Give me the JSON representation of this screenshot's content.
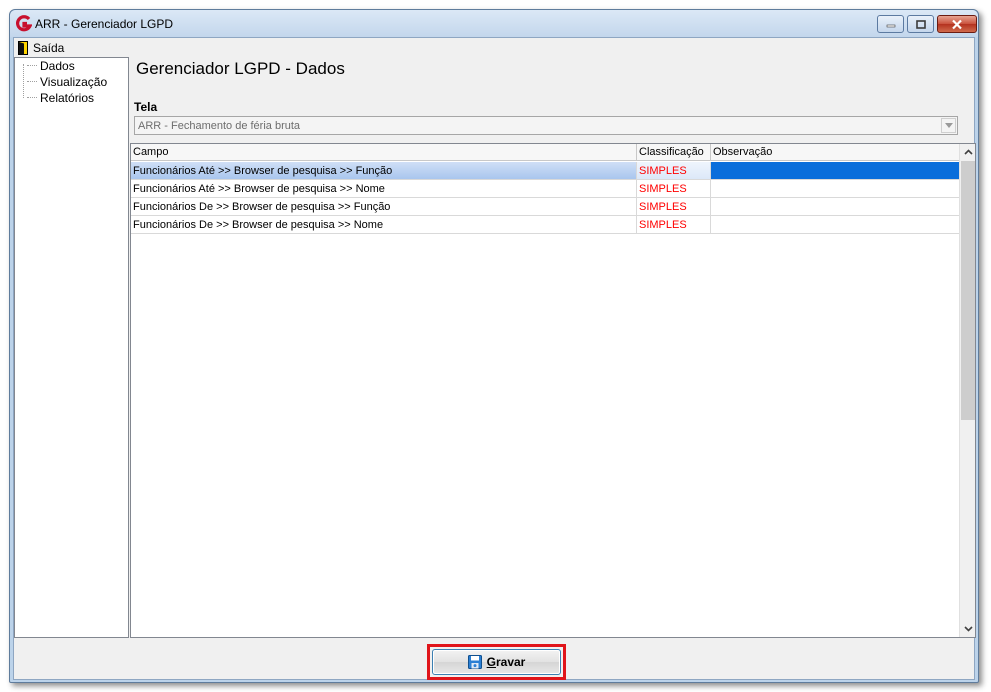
{
  "window": {
    "title": "ARR - Gerenciador LGPD"
  },
  "menu": {
    "saida": "Saída"
  },
  "nav": {
    "items": [
      {
        "label": "Dados"
      },
      {
        "label": "Visualização"
      },
      {
        "label": "Relatórios"
      }
    ]
  },
  "main": {
    "title": "Gerenciador LGPD - Dados",
    "tela_label": "Tela",
    "tela_value": "ARR - Fechamento de féria bruta"
  },
  "grid": {
    "columns": [
      "Campo",
      "Classificação",
      "Observação"
    ],
    "rows": [
      {
        "campo": "Funcionários Até >> Browser de pesquisa >> Função",
        "classificacao": "SIMPLES",
        "observacao": ""
      },
      {
        "campo": "Funcionários Até >> Browser de pesquisa >> Nome",
        "classificacao": "SIMPLES",
        "observacao": ""
      },
      {
        "campo": "Funcionários De >> Browser de pesquisa >> Função",
        "classificacao": "SIMPLES",
        "observacao": ""
      },
      {
        "campo": "Funcionários De >> Browser de pesquisa >> Nome",
        "classificacao": "SIMPLES",
        "observacao": ""
      }
    ],
    "selected_row": 0
  },
  "footer": {
    "gravar_label": "Gravar"
  },
  "colors": {
    "classification": "#ff0000",
    "selection": "#0a6edb",
    "highlight": "#e0141a"
  }
}
